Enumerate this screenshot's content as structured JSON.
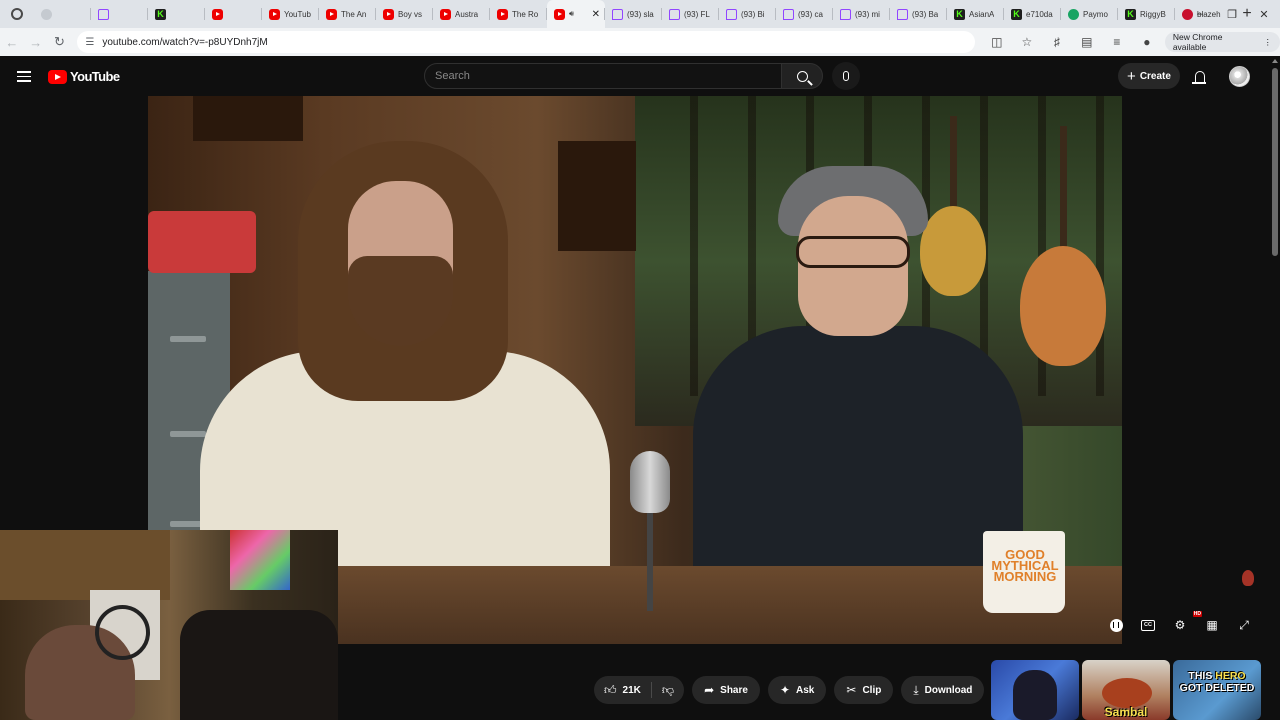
{
  "browser": {
    "tabs": [
      {
        "icon": "blank",
        "label": ""
      },
      {
        "icon": "tw",
        "label": ""
      },
      {
        "icon": "kick",
        "label": ""
      },
      {
        "icon": "yt",
        "label": ""
      },
      {
        "icon": "yt",
        "label": "YouTub"
      },
      {
        "icon": "yt",
        "label": "The An"
      },
      {
        "icon": "yt",
        "label": "Boy vs"
      },
      {
        "icon": "yt",
        "label": "Austra"
      },
      {
        "icon": "yt",
        "label": "The Ro"
      },
      {
        "icon": "yt",
        "label": "",
        "active": true
      },
      {
        "icon": "tw",
        "label": "(93) sla"
      },
      {
        "icon": "tw",
        "label": "(93) FL"
      },
      {
        "icon": "tw",
        "label": "(93) Bi"
      },
      {
        "icon": "tw",
        "label": "(93) ca"
      },
      {
        "icon": "tw",
        "label": "(93) mi"
      },
      {
        "icon": "tw",
        "label": "(93) Ba"
      },
      {
        "icon": "kick",
        "label": "AsianA"
      },
      {
        "icon": "kick",
        "label": "e710da"
      },
      {
        "icon": "green",
        "label": "Paymo"
      },
      {
        "icon": "kick",
        "label": "RiggyB"
      },
      {
        "icon": "pin",
        "label": "blazeh"
      }
    ],
    "url": "youtube.com/watch?v=-p8UYDnh7jM",
    "new_chrome_label": "New Chrome available"
  },
  "youtube": {
    "logo_text": "YouTube",
    "search_placeholder": "Search",
    "create_label": "Create",
    "like_count": "21K",
    "share_label": "Share",
    "ask_label": "Ask",
    "clip_label": "Clip",
    "download_label": "Download"
  },
  "video": {
    "mug_text": "GOOD MYTHICAL MORNING"
  },
  "thumbnails": [
    {
      "text": ""
    },
    {
      "text": "Sambal"
    },
    {
      "text_a": "THIS ",
      "text_hl": "HERO",
      "text_b": "GOT DELETED"
    }
  ],
  "colors": {
    "yt_red": "#ff0000",
    "background": "#0f0f0f",
    "pill": "#272727"
  }
}
